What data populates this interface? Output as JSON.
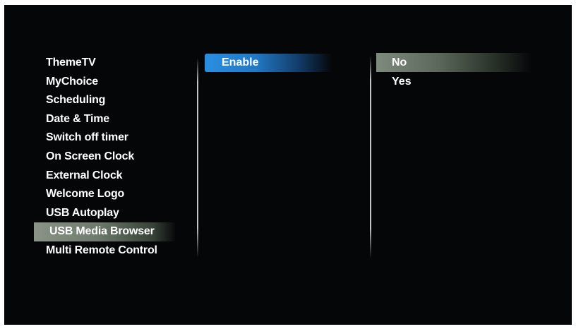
{
  "settings_menu": {
    "items": [
      {
        "label": "ThemeTV"
      },
      {
        "label": "MyChoice"
      },
      {
        "label": "Scheduling"
      },
      {
        "label": "Date & Time"
      },
      {
        "label": "Switch off timer"
      },
      {
        "label": "On Screen Clock"
      },
      {
        "label": "External Clock"
      },
      {
        "label": "Welcome Logo"
      },
      {
        "label": "USB Autoplay"
      },
      {
        "label": "USB Media Browser",
        "selected": true
      },
      {
        "label": "Multi Remote Control"
      }
    ]
  },
  "sub_menu": {
    "items": [
      {
        "label": "Enable",
        "selected": true
      }
    ]
  },
  "options_menu": {
    "items": [
      {
        "label": "No",
        "selected": true
      },
      {
        "label": "Yes"
      }
    ]
  },
  "colors": {
    "background": "#050608",
    "text": "#ffffff",
    "submenu_highlight": "#2a8fe0",
    "menu_highlight": "#8a9486"
  }
}
